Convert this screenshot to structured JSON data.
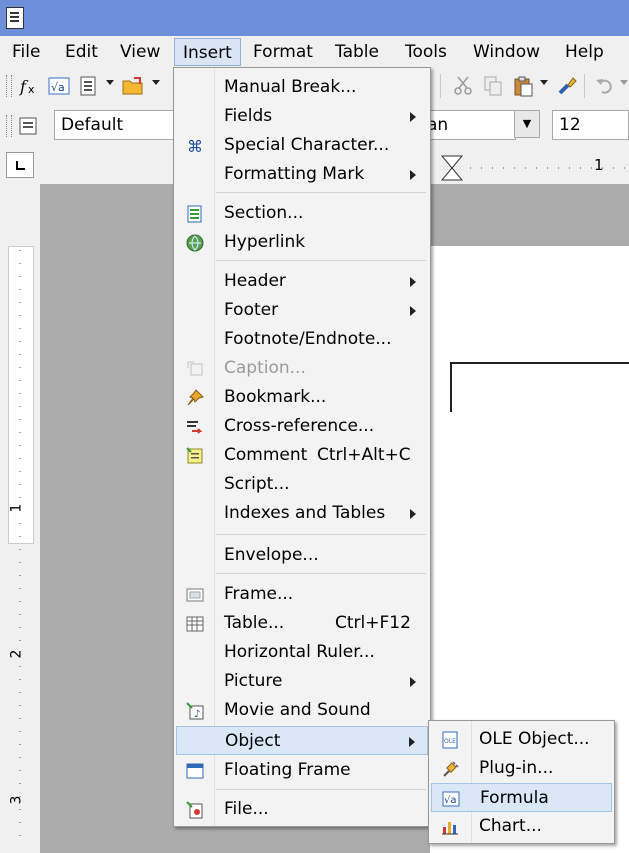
{
  "menubar": {
    "items": [
      {
        "label": "File"
      },
      {
        "label": "Edit"
      },
      {
        "label": "View"
      },
      {
        "label": "Insert"
      },
      {
        "label": "Format"
      },
      {
        "label": "Table"
      },
      {
        "label": "Tools"
      },
      {
        "label": "Window"
      },
      {
        "label": "Help"
      }
    ]
  },
  "formatting": {
    "style": "Default",
    "font_fragment": "an",
    "font_size": "12"
  },
  "ruler": {
    "h_number": "1",
    "v_numbers": [
      "1",
      "2",
      "3"
    ]
  },
  "insert_menu": {
    "items": [
      {
        "label": "Manual Break..."
      },
      {
        "label": "Fields"
      },
      {
        "label": "Special Character..."
      },
      {
        "label": "Formatting Mark"
      },
      {
        "label": "Section..."
      },
      {
        "label": "Hyperlink"
      },
      {
        "label": "Header"
      },
      {
        "label": "Footer"
      },
      {
        "label": "Footnote/Endnote..."
      },
      {
        "label": "Caption..."
      },
      {
        "label": "Bookmark..."
      },
      {
        "label": "Cross-reference..."
      },
      {
        "label": "Comment",
        "shortcut": "Ctrl+Alt+C"
      },
      {
        "label": "Script..."
      },
      {
        "label": "Indexes and Tables"
      },
      {
        "label": "Envelope..."
      },
      {
        "label": "Frame..."
      },
      {
        "label": "Table...",
        "shortcut": "Ctrl+F12"
      },
      {
        "label": "Horizontal Ruler..."
      },
      {
        "label": "Picture"
      },
      {
        "label": "Movie and Sound"
      },
      {
        "label": "Object"
      },
      {
        "label": "Floating Frame"
      },
      {
        "label": "File..."
      }
    ]
  },
  "object_submenu": {
    "items": [
      {
        "label": "OLE Object..."
      },
      {
        "label": "Plug-in..."
      },
      {
        "label": "Formula"
      },
      {
        "label": "Chart..."
      }
    ]
  },
  "colors": {
    "titlebar": "#6d8fd9",
    "highlight": "#d9e7f7",
    "workspace": "#ababab"
  }
}
